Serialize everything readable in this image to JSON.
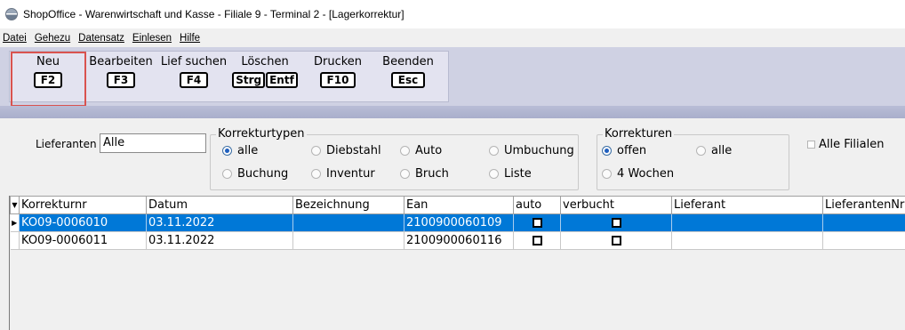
{
  "window": {
    "title": "ShopOffice - Warenwirtschaft und Kasse - Filiale 9 - Terminal 2 - [Lagerkorrektur]"
  },
  "menu": [
    "Datei",
    "Gehezu",
    "Datensatz",
    "Einlesen",
    "Hilfe"
  ],
  "toolbar": [
    {
      "label": "Neu",
      "key": "F2"
    },
    {
      "label": "Bearbeiten",
      "key": "F3"
    },
    {
      "label": "Lief suchen",
      "key": "F4"
    },
    {
      "label": "Löschen",
      "key1": "Strg",
      "key2": "Entf"
    },
    {
      "label": "Drucken",
      "key": "F10"
    },
    {
      "label": "Beenden",
      "key": "Esc"
    }
  ],
  "filters": {
    "lieferanten_label": "Lieferanten",
    "lieferanten_value": "Alle",
    "korrekturtypen": {
      "title": "Korrekturtypen",
      "options": [
        "alle",
        "Diebstahl",
        "Auto",
        "Umbuchung",
        "Buchung",
        "Inventur",
        "Bruch",
        "Liste"
      ],
      "selected": "alle"
    },
    "korrekturen": {
      "title": "Korrekturen",
      "options": [
        "offen",
        "alle",
        "4 Wochen"
      ],
      "selected": "offen"
    },
    "alle_filialen": "Alle Filialen"
  },
  "grid": {
    "columns": [
      "Korrekturnr",
      "Datum",
      "Bezeichnung",
      "Ean",
      "auto",
      "verbucht",
      "Lieferant",
      "LieferantenNr"
    ],
    "rows": [
      {
        "korrekturnr": "KO09-0006010",
        "datum": "03.11.2022",
        "bezeichnung": "",
        "ean": "2100900060109",
        "auto": false,
        "verbucht": false,
        "lieferant": "",
        "lieferantennr": ""
      },
      {
        "korrekturnr": "KO09-0006011",
        "datum": "03.11.2022",
        "bezeichnung": "",
        "ean": "2100900060116",
        "auto": false,
        "verbucht": false,
        "lieferant": "",
        "lieferantennr": ""
      }
    ],
    "selected_row": 0
  },
  "colors": {
    "selection": "#0078d7",
    "toolbar_band": "#cfd1e3",
    "highlight": "#d9534f"
  }
}
